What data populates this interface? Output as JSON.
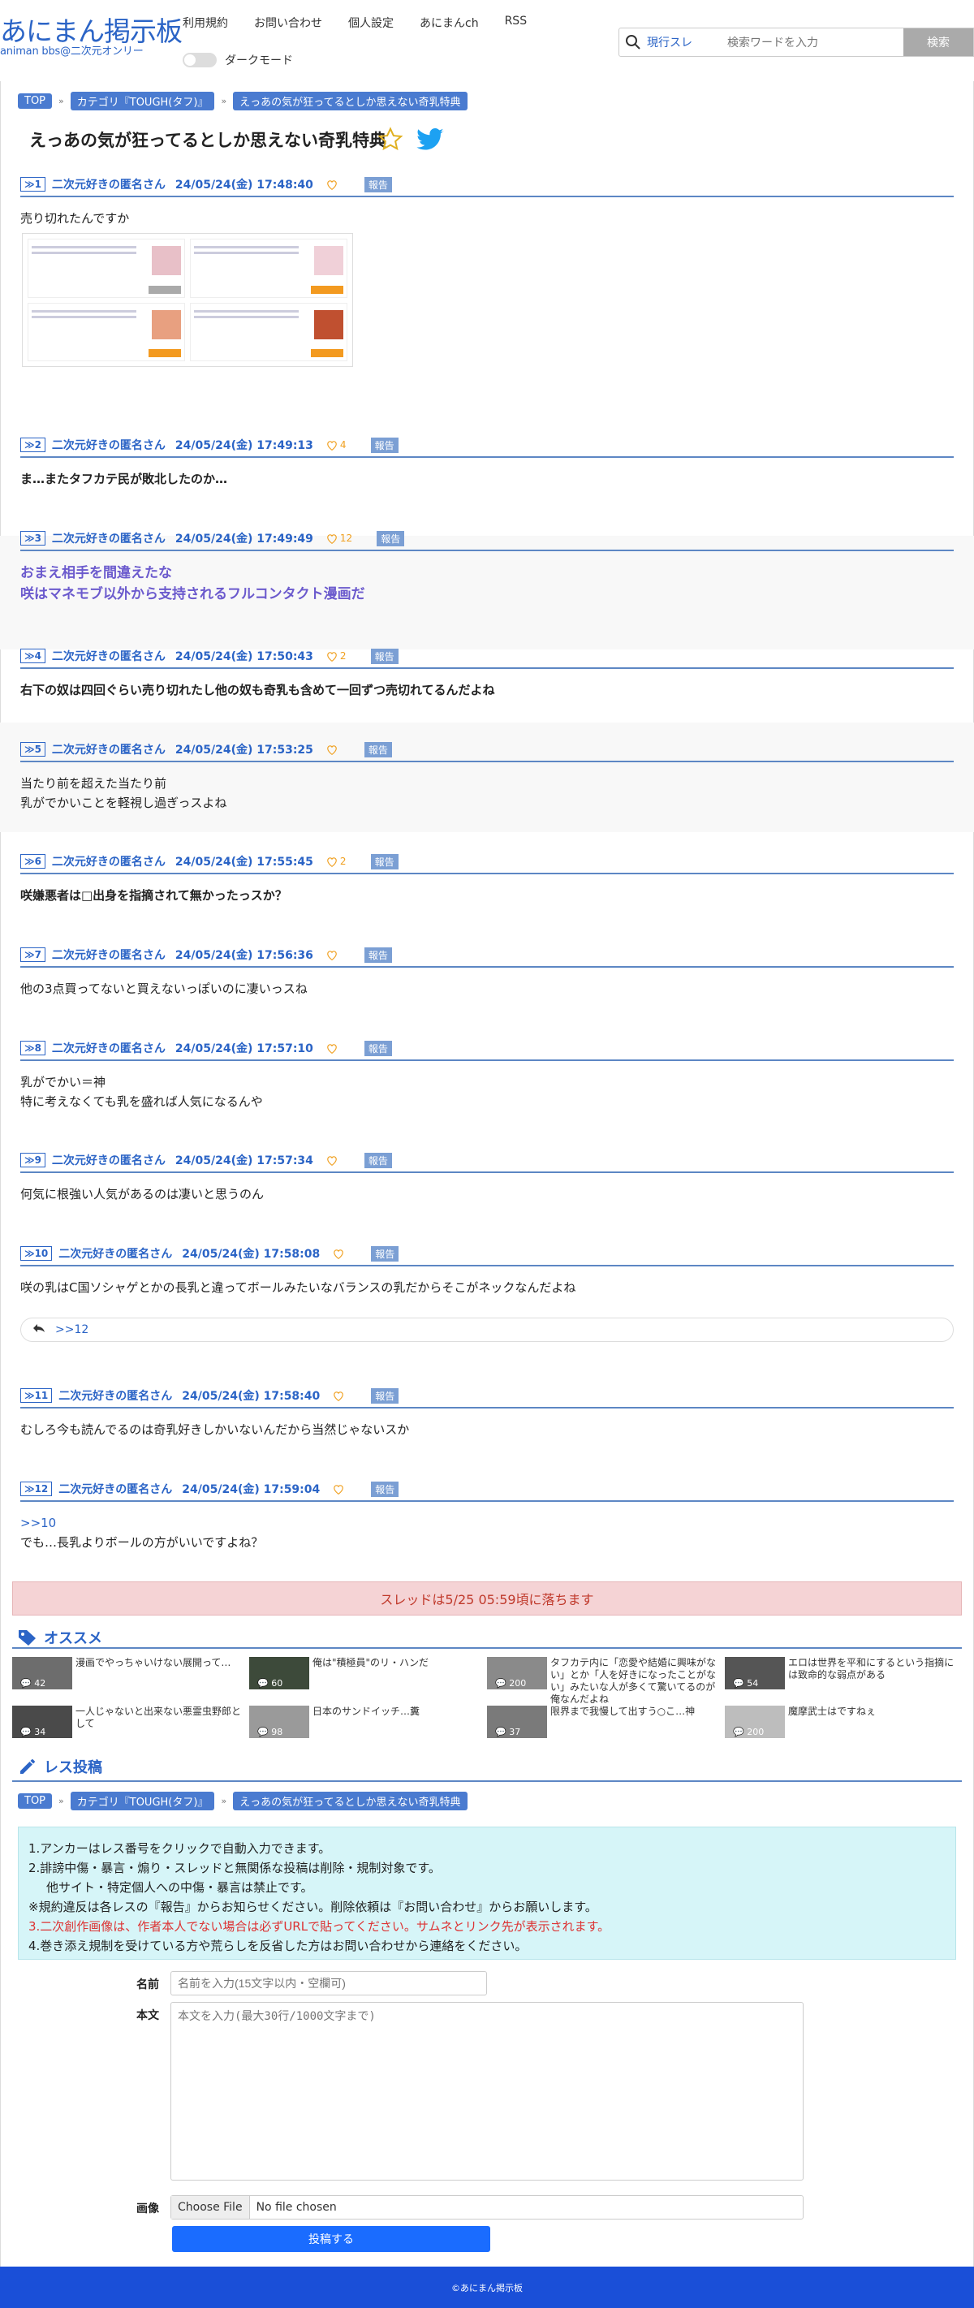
{
  "header": {
    "logo_main": "あにまん掲示板",
    "logo_sub": "animan bbs@二次元オンリー",
    "nav": [
      "利用規約",
      "お問い合わせ",
      "個人設定",
      "あにまんch",
      "RSS"
    ],
    "dark_mode_label": "ダークモード",
    "search": {
      "scope": "現行スレ",
      "placeholder": "検索ワードを入力",
      "button": "検索"
    }
  },
  "breadcrumb": {
    "top": "TOP",
    "category": "カテゴリ『TOUGH(タフ)』",
    "thread": "えっあの気が狂ってるとしか思えない奇乳特典"
  },
  "thread_title": "えっあの気が狂ってるとしか思えない奇乳特典",
  "posts": [
    {
      "num": "1",
      "name": "二次元好きの匿名さん",
      "date": "24/05/24(金) 17:48:40",
      "likes": "",
      "report": "報告",
      "lines": [
        "売り切れたんですか"
      ]
    },
    {
      "num": "2",
      "name": "二次元好きの匿名さん",
      "date": "24/05/24(金) 17:49:13",
      "likes": "4",
      "report": "報告",
      "lines": [
        "ま…またタフカテ民が敗北したのか…"
      ]
    },
    {
      "num": "3",
      "name": "二次元好きの匿名さん",
      "date": "24/05/24(金) 17:49:49",
      "likes": "12",
      "report": "報告",
      "lines": [
        "おまえ相手を間違えたな",
        "咲はマネモブ以外から支持されるフルコンタクト漫画だ"
      ]
    },
    {
      "num": "4",
      "name": "二次元好きの匿名さん",
      "date": "24/05/24(金) 17:50:43",
      "likes": "2",
      "report": "報告",
      "lines": [
        "右下の奴は四回ぐらい売り切れたし他の奴も奇乳も含めて一回ずつ売切れてるんだよね"
      ]
    },
    {
      "num": "5",
      "name": "二次元好きの匿名さん",
      "date": "24/05/24(金) 17:53:25",
      "likes": "",
      "report": "報告",
      "lines": [
        "当たり前を超えた当たり前",
        "乳がでかいことを軽視し過ぎっスよね"
      ]
    },
    {
      "num": "6",
      "name": "二次元好きの匿名さん",
      "date": "24/05/24(金) 17:55:45",
      "likes": "2",
      "report": "報告",
      "lines": [
        "咲嫌悪者は□出身を指摘されて無かったっスか？"
      ]
    },
    {
      "num": "7",
      "name": "二次元好きの匿名さん",
      "date": "24/05/24(金) 17:56:36",
      "likes": "",
      "report": "報告",
      "lines": [
        "他の3点買ってないと買えないっぽいのに凄いっスね"
      ]
    },
    {
      "num": "8",
      "name": "二次元好きの匿名さん",
      "date": "24/05/24(金) 17:57:10",
      "likes": "",
      "report": "報告",
      "lines": [
        "乳がでかい＝神",
        "特に考えなくても乳を盛れば人気になるんや"
      ]
    },
    {
      "num": "9",
      "name": "二次元好きの匿名さん",
      "date": "24/05/24(金) 17:57:34",
      "likes": "",
      "report": "報告",
      "lines": [
        "何気に根強い人気があるのは凄いと思うのん"
      ]
    },
    {
      "num": "10",
      "name": "二次元好きの匿名さん",
      "date": "24/05/24(金) 17:58:08",
      "likes": "",
      "report": "報告",
      "lines": [
        "咲の乳はC国ソシャゲとかの長乳と違ってボールみたいなバランスの乳だからそこがネックなんだよね"
      ],
      "replies": ">>12"
    },
    {
      "num": "11",
      "name": "二次元好きの匿名さん",
      "date": "24/05/24(金) 17:58:40",
      "likes": "",
      "report": "報告",
      "lines": [
        "むしろ今も読んでるのは奇乳好きしかいないんだから当然じゃないスか"
      ]
    },
    {
      "num": "12",
      "name": "二次元好きの匿名さん",
      "date": "24/05/24(金) 17:59:04",
      "likes": "",
      "report": "報告",
      "anchor": ">>10",
      "lines": [
        "でも…長乳よりボールの方がいいですよね？"
      ]
    }
  ],
  "banner": "スレッドは5/25 05:59頃に落ちます",
  "recommend": {
    "heading": "オススメ",
    "items": [
      {
        "title": "漫画でやっちゃいけない展開って…",
        "count": "42",
        "thumb": "#6d6d6d"
      },
      {
        "title": "俺は\"積極員\"のリ・ハンだ",
        "count": "60",
        "thumb": "#3d4a3a"
      },
      {
        "title": "タフカテ内に「恋愛や結婚に興味がない」とか「人を好きになったことがない」みたいな人が多くて驚いてるのが俺なんだよね",
        "count": "200",
        "thumb": "#8a8a8a"
      },
      {
        "title": "エロは世界を平和にするという指摘には致命的な弱点がある",
        "count": "54",
        "thumb": "#555"
      },
      {
        "title": "一人じゃないと出来ない悪霊虫野郎として",
        "count": "34",
        "thumb": "#4a4a4a"
      },
      {
        "title": "日本のサンドイッチ…糞",
        "count": "98",
        "thumb": "#9a9a9a"
      },
      {
        "title": "限界まで我慢して出すう○こ…神",
        "count": "37",
        "thumb": "#7a7a7a"
      },
      {
        "title": "魔摩武士はですねぇ",
        "count": "200",
        "thumb": "#bdbdbd"
      }
    ]
  },
  "post_form": {
    "heading": "レス投稿",
    "rules": [
      "1.アンカーはレス番号をクリックで自動入力できます。",
      "2.誹謗中傷・暴言・煽り・スレッドと無関係な投稿は削除・規制対象です。",
      "他サイト・特定個人への中傷・暴言は禁止です。",
      "※規約違反は各レスの『報告』からお知らせください。削除依頼は『お問い合わせ』からお願いします。",
      "3.二次創作画像は、作者本人でない場合は必ずURLで貼ってください。サムネとリンク先が表示されます。",
      "4.巻き添え規制を受けている方や荒らしを反省した方はお問い合わせから連絡をください。"
    ],
    "name_label": "名前",
    "name_placeholder": "名前を入力(15文字以内・空欄可)",
    "body_label": "本文",
    "body_placeholder": "本文を入力(最大30行/1000文字まで)",
    "image_label": "画像",
    "file_button": "Choose File",
    "file_status": "No file chosen",
    "submit": "投稿する"
  },
  "footer": "©あにまん掲示板",
  "colors": {
    "accent": "#2b64c6",
    "banner_bg": "#f5d3d5",
    "rules_bg": "#d6f5f8",
    "footer": "#1a4fd8",
    "like": "#f0a020"
  }
}
